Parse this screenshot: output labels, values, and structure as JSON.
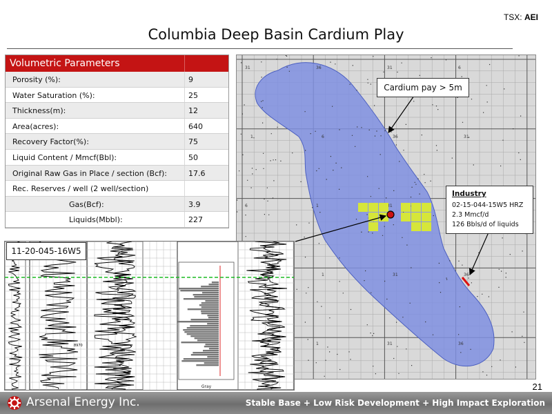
{
  "ticker": {
    "prefix": "TSX:",
    "symbol": "AEI"
  },
  "title": "Columbia Deep Basin Cardium Play",
  "volumetrics": {
    "heading": "Volumetric Parameters",
    "rows": [
      {
        "label": "Porosity (%):",
        "value": "9"
      },
      {
        "label": "Water Saturation (%):",
        "value": "25"
      },
      {
        "label": "Thickness(m):",
        "value": "12"
      },
      {
        "label": "Area(acres):",
        "value": "640"
      },
      {
        "label": "Recovery Factor(%):",
        "value": "75"
      },
      {
        "label": "Liquid Content / Mmcf(Bbl):",
        "value": "50"
      },
      {
        "label": "Original Raw Gas in Place / section (Bcf):",
        "value": "17.6"
      },
      {
        "label": "Rec. Reserves / well (2 well/section)",
        "value": ""
      },
      {
        "label": "Gas(Bcf):",
        "value": "3.9"
      },
      {
        "label": "Liquids(Mbbl):",
        "value": "227"
      }
    ]
  },
  "map": {
    "pay_callout": "Cardium pay > 5m",
    "industry": {
      "heading": "Industry",
      "well": "02-15-044-15W5 HRZ",
      "gas_rate": "2.3 Mmcf/d",
      "liquids_rate": "126 Bbls/d of liquids"
    },
    "colors": {
      "pay_fill": "#7f8fe0",
      "land": "#d9d9d9",
      "well_sections": "#d6e63a",
      "well_dot": "#cc1111",
      "industry_mark": "#dd1111"
    }
  },
  "log": {
    "well_label": "11-20-045-16W5",
    "depth_marker": "8970",
    "histogram_xlabel": "Gray"
  },
  "page_number": "21",
  "footer": {
    "company": "Arsenal Energy Inc.",
    "tagline": "Stable Base + Low Risk Development + High Impact Exploration"
  }
}
